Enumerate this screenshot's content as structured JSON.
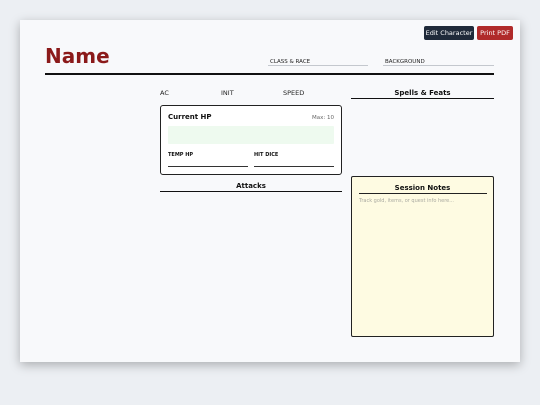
{
  "toolbar": {
    "edit_label": "Edit Character",
    "print_label": "Print PDF"
  },
  "header": {
    "name": "Name",
    "class_race_label": "CLASS & RACE",
    "background_label": "BACKGROUND"
  },
  "stats": {
    "ac_label": "AC",
    "init_label": "INIT",
    "speed_label": "SPEED"
  },
  "spells": {
    "title": "Spells & Feats"
  },
  "hp": {
    "title": "Current HP",
    "max": "Max: 10",
    "temp_label": "TEMP HP",
    "hit_dice_label": "HIT DICE"
  },
  "attacks": {
    "title": "Attacks"
  },
  "notes": {
    "title": "Session Notes",
    "placeholder": "Track gold, items, or quest info here..."
  },
  "colors": {
    "name_accent": "#8b1a1a",
    "edit_button": "#1f2a3a",
    "print_button": "#b02a2a",
    "hp_field": "#eefaef",
    "notes_background": "#fefbe2"
  }
}
